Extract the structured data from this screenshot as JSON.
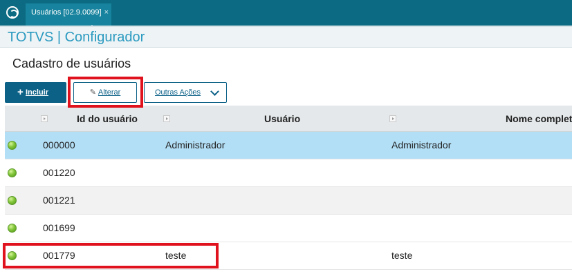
{
  "tab": {
    "label": "Usuários [02.9.0099]",
    "close": "×"
  },
  "app": {
    "title": "TOTVS | Configurador"
  },
  "page": {
    "title": "Cadastro de usuários"
  },
  "toolbar": {
    "incluir_icon": "+",
    "incluir_label": "Incluir",
    "alterar_icon": "✎",
    "alterar_label": "Alterar",
    "outras_label": "Outras Ações"
  },
  "table": {
    "columns": [
      "Id do usuário",
      "Usuário",
      "Nome completo"
    ],
    "rows": [
      {
        "status": "active",
        "id": "000000",
        "usuario": "Administrador",
        "nome": "Administrador"
      },
      {
        "status": "active",
        "id": "001220",
        "usuario": "",
        "nome": ""
      },
      {
        "status": "active",
        "id": "001221",
        "usuario": "",
        "nome": ""
      },
      {
        "status": "active",
        "id": "001699",
        "usuario": "",
        "nome": ""
      },
      {
        "status": "active",
        "id": "001779",
        "usuario": "teste",
        "nome": "teste"
      }
    ]
  },
  "colors": {
    "topbar": "#0c6b83",
    "accent": "#0c6187",
    "selected_row": "#b3dff6",
    "highlight_box": "#e0121d",
    "status_active": "#82c63a"
  }
}
